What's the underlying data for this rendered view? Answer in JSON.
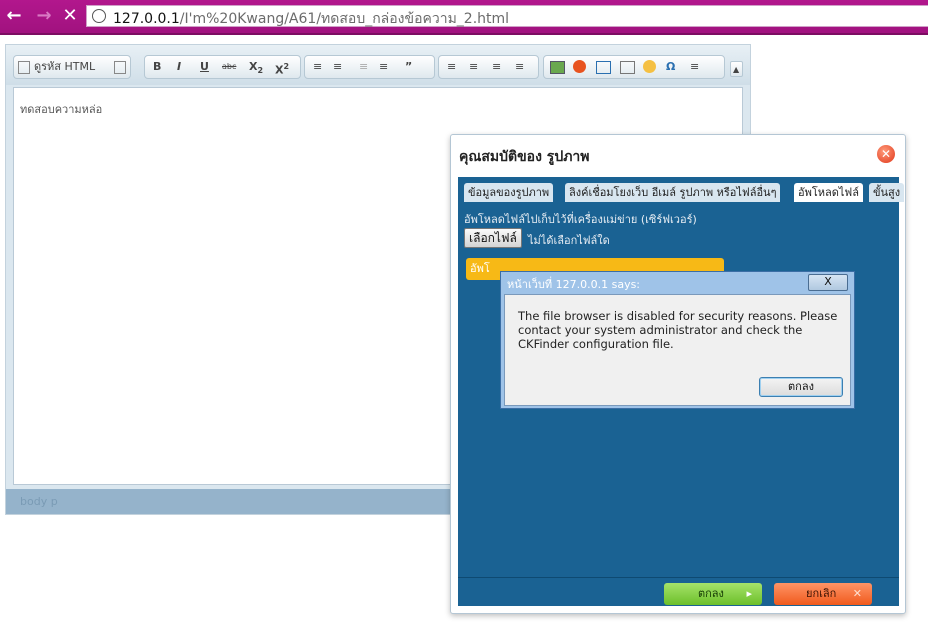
{
  "browser": {
    "url_host": "127.0.0.1",
    "url_path": "/I'm%20Kwang/A61/ทดสอบ_กล่องข้อความ_2.html"
  },
  "editor": {
    "source_button": "ดูรหัส HTML",
    "content_text": "ทดสอบความหล่อ",
    "status_path": "body p"
  },
  "image_dialog": {
    "title": "คุณสมบัติของ รูปภาพ",
    "tabs": [
      "ข้อมูลของรูปภาพ",
      "ลิงค์เชื่อมโยงเว็บ อีเมล์ รูปภาพ หรือไฟล์อื่นๆ",
      "อัพโหลดไฟล์",
      "ขั้นสูง"
    ],
    "upload_label": "อัพโหลดไฟล์ไปเก็บไว้ที่เครื่องแม่ข่าย (เซิร์ฟเวอร์)",
    "choose_file": "เลือกไฟล์",
    "no_file": "ไม่ได้เลือกไฟล์ใด",
    "send_button": "อัพโ",
    "ok_button": "ตกลง",
    "cancel_button": "ยกเลิก"
  },
  "alert": {
    "title": "หน้าเว็บที่ 127.0.0.1 says:",
    "message": "The file browser is disabled for security reasons. Please contact your system administrator and check the CKFinder configuration file.",
    "ok_button": "ตกลง",
    "close_label": "X"
  }
}
